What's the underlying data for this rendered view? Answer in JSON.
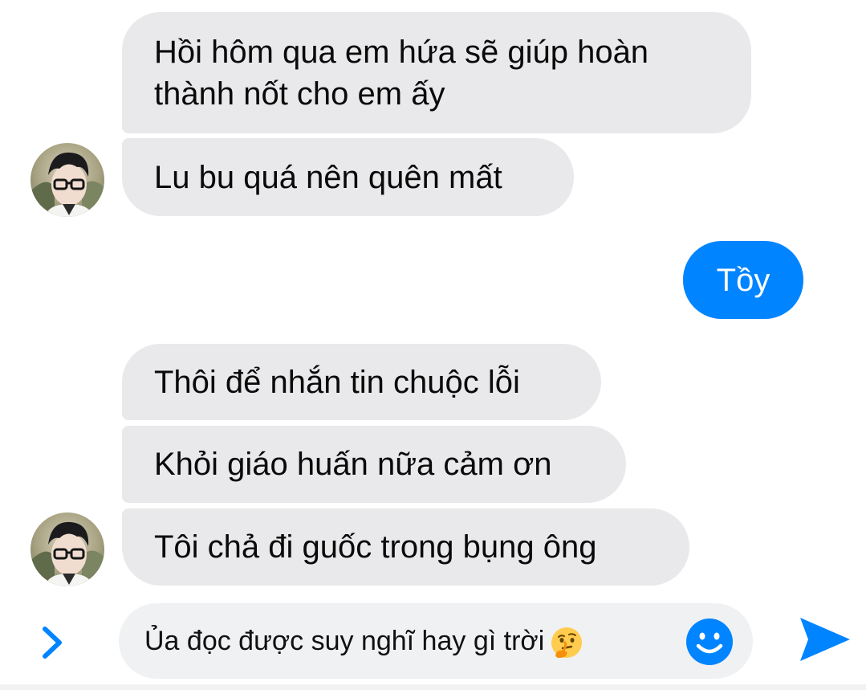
{
  "conversation": {
    "messages": [
      {
        "direction": "received",
        "text": "Hồi hôm qua em hứa sẽ giúp hoàn thành nốt cho em ấy"
      },
      {
        "direction": "received",
        "text": "Lu bu quá nên quên mất"
      },
      {
        "direction": "sent",
        "text": "Tồy"
      },
      {
        "direction": "received",
        "text": "Thôi để nhắn tin chuộc lỗi"
      },
      {
        "direction": "received",
        "text": "Khỏi giáo huấn nữa cảm ơn"
      },
      {
        "direction": "received",
        "text": "Tôi chả đi guốc trong bụng ông"
      }
    ]
  },
  "composer": {
    "draft_text": "Ủa đọc được suy nghĩ hay gì trời",
    "draft_emoji": "thinking-face",
    "expand_icon": "chevron-right-icon",
    "emoji_icon": "smiley-icon",
    "send_icon": "send-icon"
  },
  "colors": {
    "accent": "#0084ff",
    "received_bubble": "#e9e9eb",
    "sent_bubble": "#0084ff",
    "input_background": "#f0f1f3"
  }
}
